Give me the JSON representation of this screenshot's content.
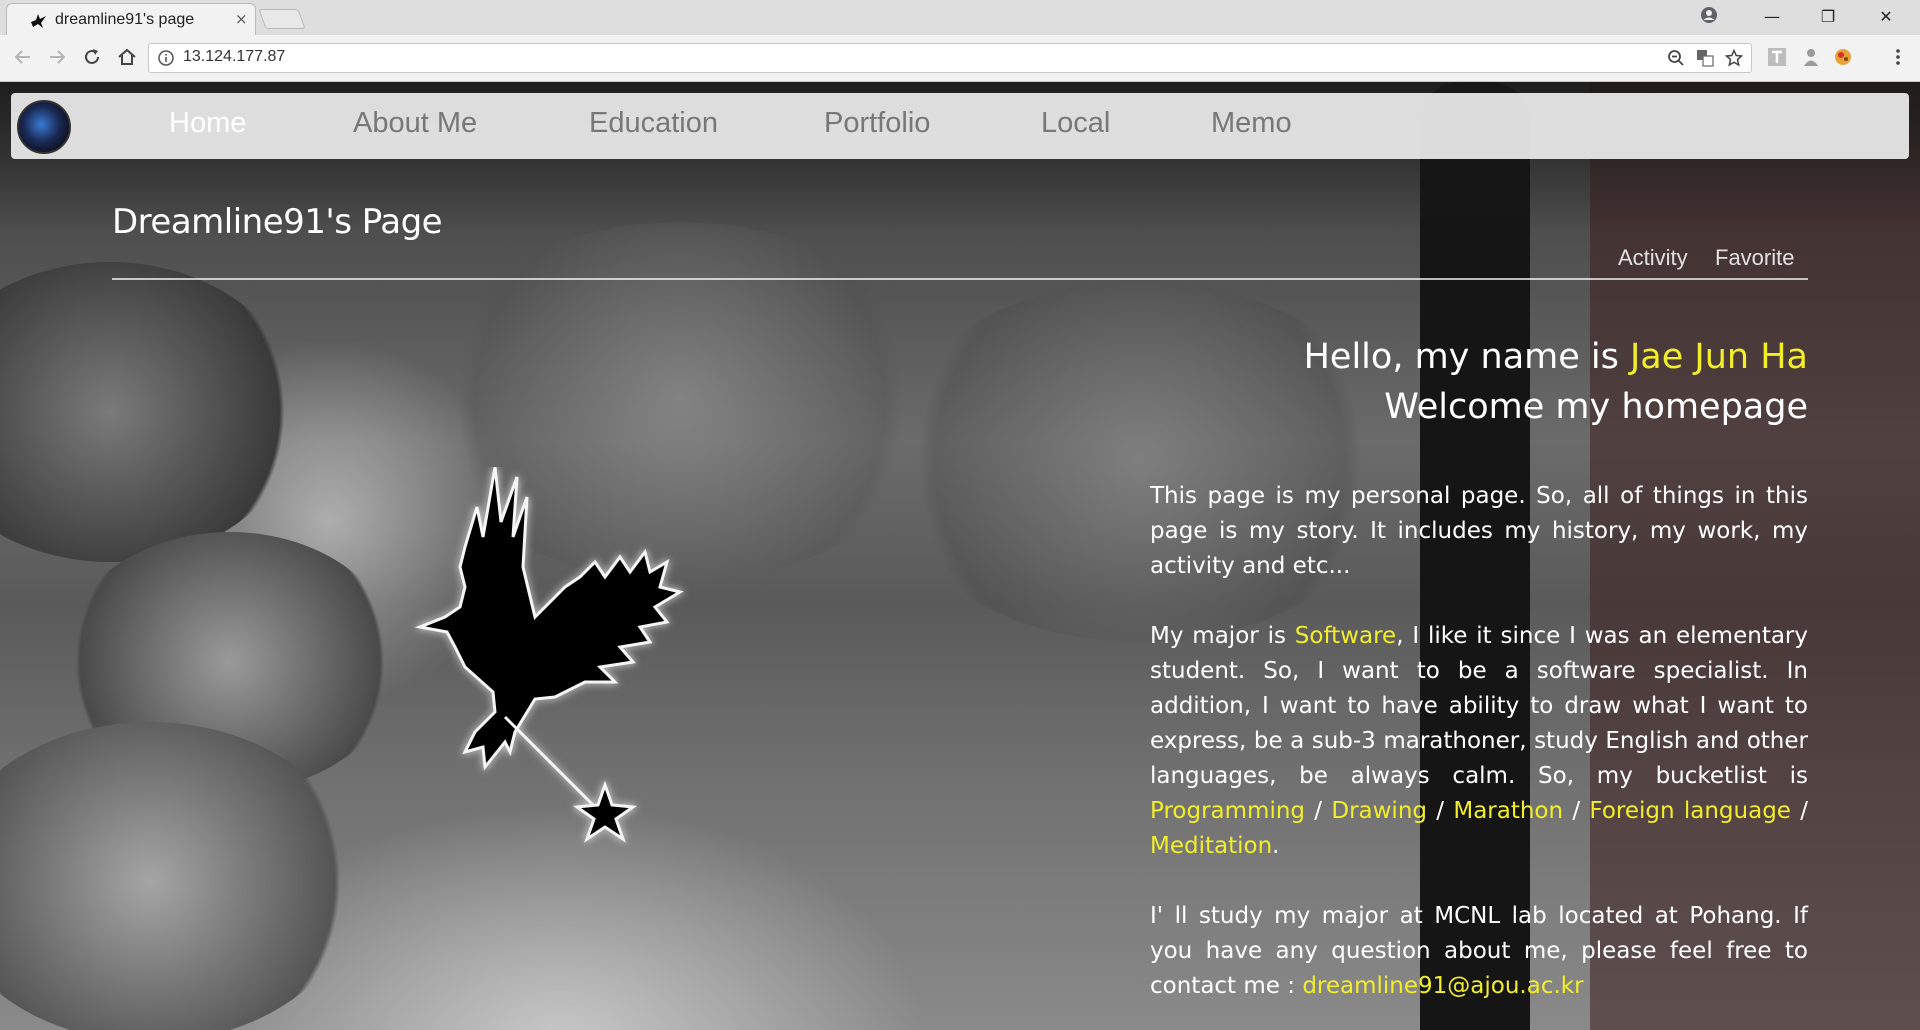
{
  "browser": {
    "tab_title": "dreamline91's page",
    "tab_close": "×",
    "url": "13.124.177.87",
    "window_controls": {
      "minimize": "—",
      "restore": "❐",
      "close": "✕"
    }
  },
  "nav": {
    "items": [
      "Home",
      "About Me",
      "Education",
      "Portfolio",
      "Local",
      "Memo"
    ],
    "active": "Home"
  },
  "page": {
    "title": "Dreamline91's Page",
    "sub_links": [
      "Activity",
      "Favorite"
    ]
  },
  "intro": {
    "greet_prefix": "Hello, my name is ",
    "name": "Jae Jun Ha",
    "welcome": "Welcome my homepage"
  },
  "body": {
    "p1": "This page is my personal page. So, all of things in this page is my story. It includes my history, my work, my activity and etc...",
    "p2_a": "My major is ",
    "major": "Software",
    "p2_b": ", I like it since I was an elementary student. So, I want to be a software specialist. In addition, I want to have ability to draw what I want to express, be a sub-3 marathoner, study English and other languages, be always calm. So, my bucketlist is ",
    "bucket": [
      "Programming",
      "Drawing",
      "Marathon",
      "Foreign language",
      "Meditation"
    ],
    "sep": " / ",
    "end": ".",
    "p3": "I' ll study my major at MCNL lab located at Pohang. If you have any question about me, please feel free to contact me : ",
    "email": "dreamline91@ajou.ac.kr"
  },
  "colors": {
    "highlight": "#f2ee2a",
    "nav_active": "#ffffff",
    "nav_text": "#777777"
  }
}
